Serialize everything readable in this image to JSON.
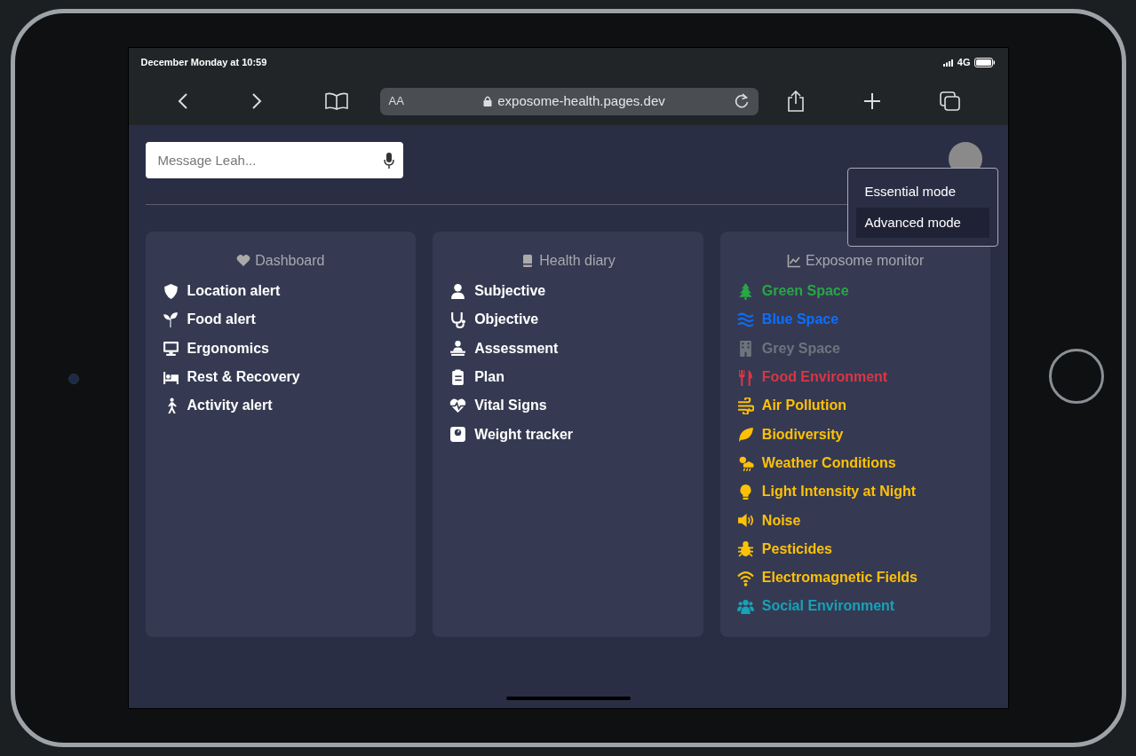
{
  "status_bar": {
    "time": "December Monday at 10:59",
    "network": "4G"
  },
  "browser": {
    "text_size": "AA",
    "url": "exposome-health.pages.dev"
  },
  "message": {
    "placeholder": "Message Leah..."
  },
  "mode_menu": [
    {
      "label": "Essential mode",
      "selected": false
    },
    {
      "label": "Advanced mode",
      "selected": true
    }
  ],
  "cards": [
    {
      "title": "Dashboard",
      "items": [
        {
          "label": "Location alert"
        },
        {
          "label": "Food alert"
        },
        {
          "label": "Ergonomics"
        },
        {
          "label": "Rest & Recovery"
        },
        {
          "label": "Activity alert"
        }
      ]
    },
    {
      "title": "Health diary",
      "items": [
        {
          "label": "Subjective"
        },
        {
          "label": "Objective"
        },
        {
          "label": "Assessment"
        },
        {
          "label": "Plan"
        },
        {
          "label": "Vital Signs"
        },
        {
          "label": "Weight tracker"
        }
      ]
    },
    {
      "title": "Exposome monitor",
      "items": [
        {
          "label": "Green Space",
          "color": "#28a745"
        },
        {
          "label": "Blue Space",
          "color": "#0d6efd"
        },
        {
          "label": "Grey Space",
          "color": "#6c757d"
        },
        {
          "label": "Food Environment",
          "color": "#dc3545"
        },
        {
          "label": "Air Pollution",
          "color": "#ffc107"
        },
        {
          "label": "Biodiversity",
          "color": "#ffc107"
        },
        {
          "label": "Weather Conditions",
          "color": "#ffc107"
        },
        {
          "label": "Light Intensity at Night",
          "color": "#ffc107"
        },
        {
          "label": "Noise",
          "color": "#ffc107"
        },
        {
          "label": "Pesticides",
          "color": "#ffc107"
        },
        {
          "label": "Electromagnetic Fields",
          "color": "#ffc107"
        },
        {
          "label": "Social Environment",
          "color": "#17a2b8"
        }
      ]
    }
  ]
}
